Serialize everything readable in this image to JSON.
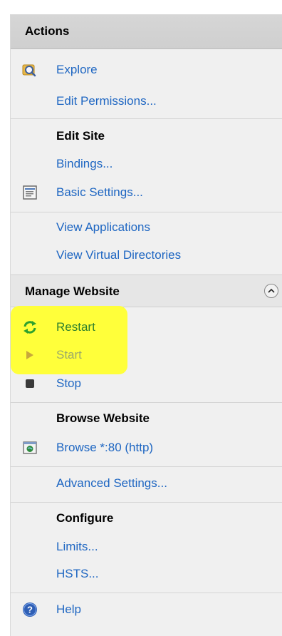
{
  "panel": {
    "title": "Actions"
  },
  "items": {
    "explore": "Explore",
    "edit_permissions": "Edit Permissions...",
    "edit_site_heading": "Edit Site",
    "bindings": "Bindings...",
    "basic_settings": "Basic Settings...",
    "view_applications": "View Applications",
    "view_virtual_directories": "View Virtual Directories"
  },
  "manage_website": {
    "title": "Manage Website",
    "restart": "Restart",
    "start": "Start",
    "stop": "Stop",
    "browse_heading": "Browse Website",
    "browse_80": "Browse *:80 (http)",
    "advanced_settings": "Advanced Settings...",
    "configure_heading": "Configure",
    "limits": "Limits...",
    "hsts": "HSTS...",
    "help": "Help"
  },
  "colors": {
    "link": "#1e66c2",
    "highlight": "#ffff3a"
  },
  "icons": {
    "explore": "folder-search-icon",
    "basic_settings": "settings-sheet-icon",
    "restart": "restart-arrows-icon",
    "start": "play-icon",
    "stop": "stop-square-icon",
    "browse": "browser-globe-icon",
    "help": "help-icon",
    "collapse": "chevron-up-icon"
  }
}
